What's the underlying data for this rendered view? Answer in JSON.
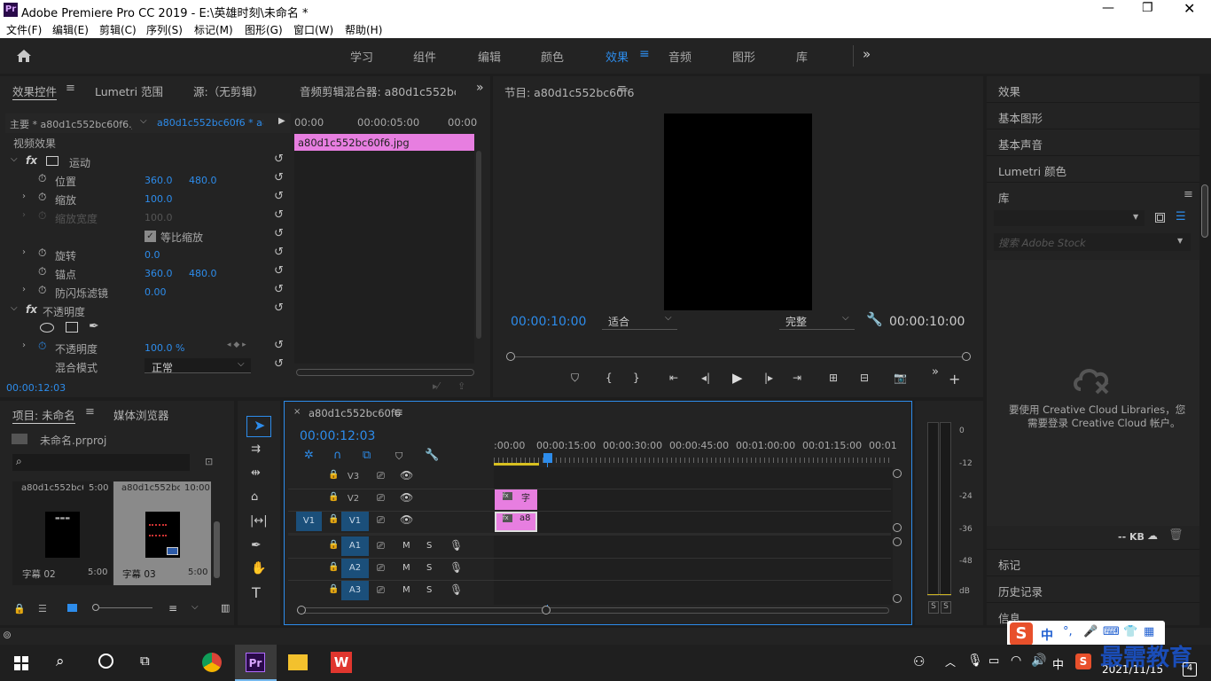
{
  "app": {
    "title": "Adobe Premiere Pro CC 2019 - E:\\英雄时刻\\未命名 *",
    "icon": "Pr"
  },
  "menu": [
    "文件(F)",
    "编辑(E)",
    "剪辑(C)",
    "序列(S)",
    "标记(M)",
    "图形(G)",
    "窗口(W)",
    "帮助(H)"
  ],
  "workspaces": {
    "items": [
      "学习",
      "组件",
      "编辑",
      "颜色",
      "效果",
      "音频",
      "图形",
      "库"
    ],
    "active": "效果"
  },
  "colors": {
    "accent": "#2d8ceb",
    "clip": "#e77ee0"
  },
  "effect_controls": {
    "tabs": [
      "效果控件",
      "Lumetri 范围",
      "源:（无剪辑）",
      "音频剪辑混合器: a80d1c552bc60"
    ],
    "master": "主要 * a80d1c552bc60f6.j...",
    "sequence": "a80d1c552bc60f6 * a8...",
    "ruler": [
      "00:00",
      "00:00:05:00",
      "00:00"
    ],
    "clip": "a80d1c552bc60f6.jpg",
    "video_effects": "视频效果",
    "rows": [
      {
        "name": "运动",
        "kind": "fx"
      },
      {
        "name": "位置",
        "v1": "360.0",
        "v2": "480.0"
      },
      {
        "name": "缩放",
        "v1": "100.0"
      },
      {
        "name": "缩放宽度",
        "v1": "100.0",
        "disabled": true
      },
      {
        "name": "等比缩放",
        "kind": "check"
      },
      {
        "name": "旋转",
        "v1": "0.0"
      },
      {
        "name": "锚点",
        "v1": "360.0",
        "v2": "480.0"
      },
      {
        "name": "防闪烁滤镜",
        "v1": "0.00"
      },
      {
        "name": "不透明度",
        "kind": "fx"
      },
      {
        "name": "不透明度",
        "v1": "100.0 %"
      },
      {
        "name": "混合模式",
        "v1": "正常"
      }
    ],
    "timecode": "00:00:12:03"
  },
  "program": {
    "title": "节目: a80d1c552bc60f6",
    "timecode_left": "00:00:10:00",
    "fit": "适合",
    "quality": "完整",
    "timecode_right": "00:00:10:00"
  },
  "right_panel": {
    "items": [
      "效果",
      "基本图形",
      "基本声音",
      "Lumetri 颜色"
    ],
    "library": "库",
    "search_placeholder": "搜索 Adobe Stock",
    "message_1": "要使用 Creative Cloud Libraries，您",
    "message_2": "需要登录 Creative Cloud 帐户。",
    "kb": "-- KB",
    "bottom": [
      "标记",
      "历史记录",
      "信息"
    ]
  },
  "project": {
    "tabs": [
      "项目: 未命名",
      "媒体浏览器"
    ],
    "file": "未命名.prproj",
    "thumbs": [
      {
        "name": "a80d1c552bc6...",
        "dur": "5:00",
        "label": "字幕 02",
        "d2": "5:00"
      },
      {
        "name": "a80d1c552bc...",
        "dur": "10:00",
        "label": "字幕 03",
        "d2": "5:00"
      }
    ]
  },
  "timeline": {
    "title": "a80d1c552bc60f6",
    "timecode": "00:00:12:03",
    "ruler": [
      ":00:00",
      "00:00:15:00",
      "00:00:30:00",
      "00:00:45:00",
      "00:01:00:00",
      "00:01:15:00",
      "00:01"
    ],
    "video_tracks": [
      "V3",
      "V2",
      "V1"
    ],
    "audio_tracks": [
      "A1",
      "A2",
      "A3"
    ],
    "src": "V1",
    "clips": [
      {
        "track": "V2",
        "label": "字"
      },
      {
        "track": "V1",
        "label": "a8"
      }
    ]
  },
  "meter": {
    "ticks": [
      "0",
      "-12",
      "-24",
      "-36",
      "-48",
      "dB"
    ],
    "solo": [
      "S",
      "S"
    ]
  },
  "taskbar": {
    "date": "2021/11/15",
    "ime": "中",
    "brand": "最需教育",
    "notif": "4"
  }
}
